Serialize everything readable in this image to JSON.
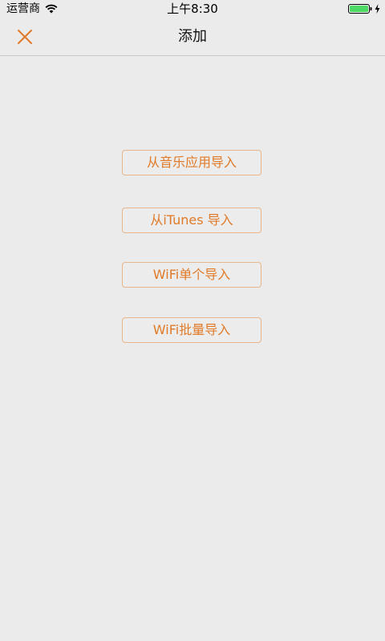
{
  "status_bar": {
    "carrier": "运营商",
    "time": "上午8:30",
    "wifi_icon": "wifi-icon",
    "battery_icon": "battery-icon",
    "charge_icon": "charging-bolt-icon"
  },
  "nav": {
    "title": "添加",
    "close_icon": "close-icon"
  },
  "import_options": [
    {
      "label": "从音乐应用导入"
    },
    {
      "label": "从iTunes 导入"
    },
    {
      "label": "WiFi单个导入"
    },
    {
      "label": "WiFi批量导入"
    }
  ],
  "colors": {
    "accent": "#e07a28",
    "button_border": "#e8b68a",
    "background": "#ebebeb",
    "battery": "#4cd964"
  }
}
